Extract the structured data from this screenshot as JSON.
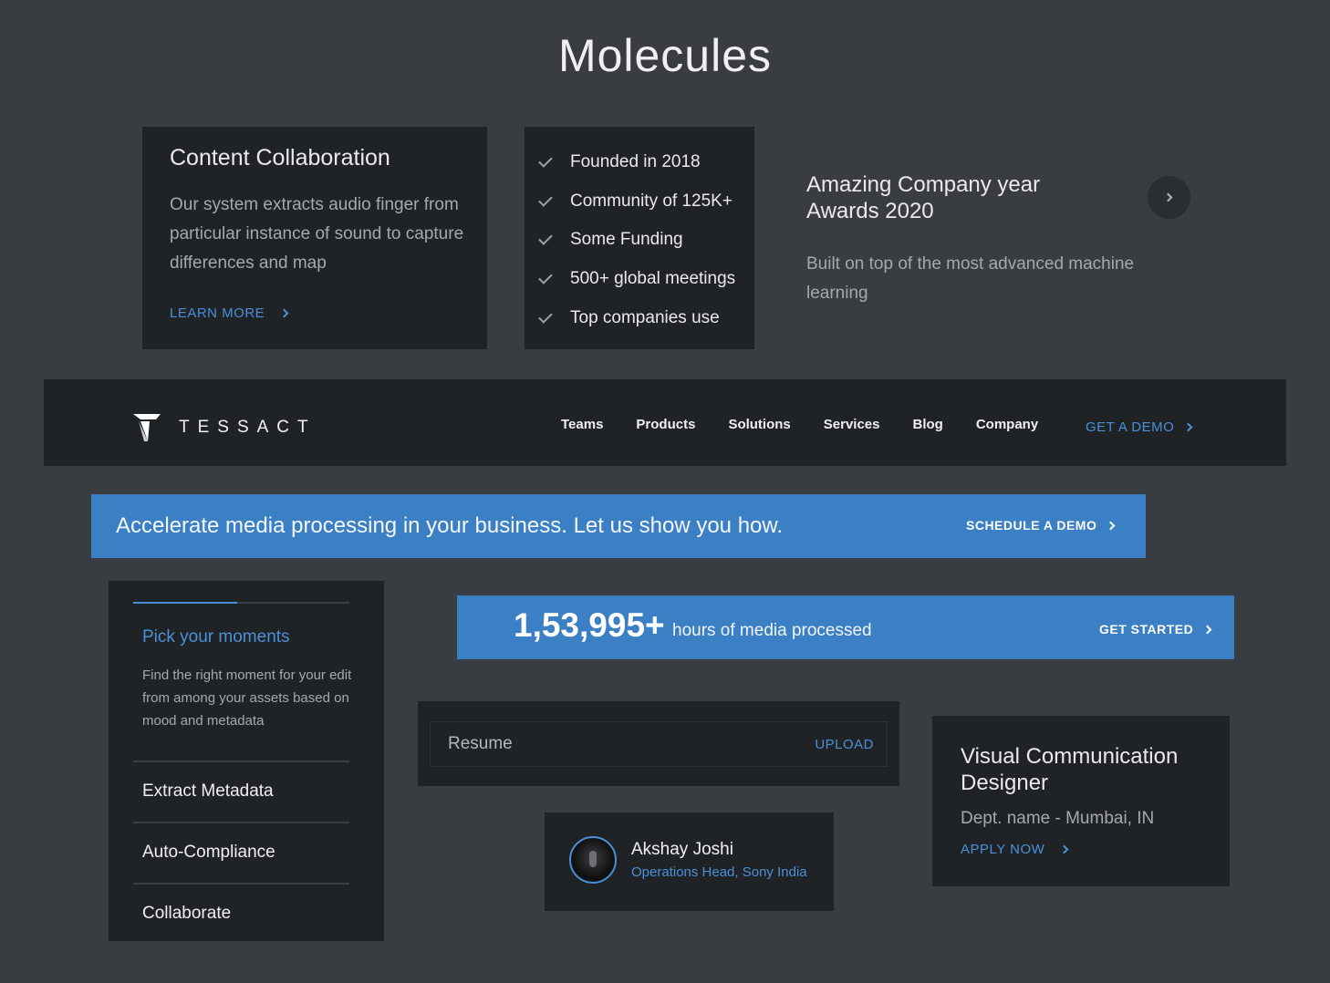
{
  "page": {
    "title": "Molecules"
  },
  "content_card": {
    "title": "Content Collaboration",
    "body": "Our system extracts audio finger from particular instance of sound to capture differences and map",
    "link": "LEARN MORE"
  },
  "checklist": {
    "items": [
      "Founded in 2018",
      "Community of 125K+",
      "Some Funding",
      "500+ global meetings",
      "Top companies use"
    ]
  },
  "award": {
    "title": "Amazing Company year Awards 2020",
    "body": "Built on top of the most advanced machine learning"
  },
  "navbar": {
    "logo": "TESSACT",
    "items": [
      "Teams",
      "Products",
      "Solutions",
      "Services",
      "Blog",
      "Company"
    ],
    "cta": "GET A DEMO"
  },
  "banner_demo": {
    "text": "Accelerate media processing in your business. Let us show you how.",
    "cta": "SCHEDULE A DEMO"
  },
  "banner_stats": {
    "number": "1,53,995+",
    "text": "hours of media processed",
    "cta": "GET STARTED"
  },
  "accordion": {
    "progress": 0.48,
    "active_title": "Pick your moments",
    "active_desc": "Find the right moment for your edit from among your assets based on mood and metadata",
    "items": [
      "Extract Metadata",
      "Auto-Compliance",
      "Collaborate"
    ]
  },
  "upload": {
    "label": "Resume",
    "action": "UPLOAD"
  },
  "profile": {
    "name": "Akshay Joshi",
    "role": "Operations Head, Sony India"
  },
  "job": {
    "title": "Visual Communication Designer",
    "dept": "Dept. name - Mumbai, IN",
    "cta": "APPLY NOW"
  },
  "colors": {
    "background": "#393c41",
    "card": "#202326",
    "accent": "#4a90d9",
    "banner": "#3b7fc4"
  }
}
